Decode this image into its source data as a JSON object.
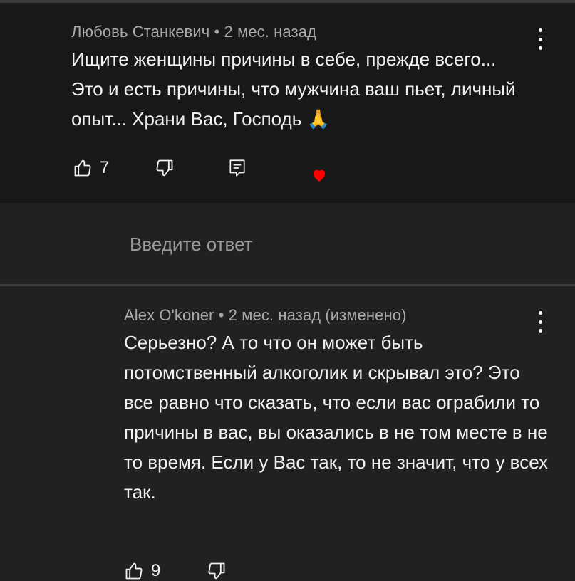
{
  "comment1": {
    "author": "Любовь Станкевич",
    "separator": "•",
    "time": "2 мес. назад",
    "text": "Ищите женщины причины в себе, прежде всего... Это и есть причины, что мужчина ваш пьет, личный опыт... Храни Вас, Господь 🙏",
    "likes": "7",
    "icons": [
      "thumbs-up-icon",
      "thumbs-down-icon",
      "reply-icon",
      "heart-icon",
      "more-vert-icon"
    ],
    "heart_color": "#ff0000"
  },
  "reply_input": {
    "placeholder": "Введите ответ"
  },
  "comment2": {
    "author": "Alex O'koner",
    "separator": "•",
    "time": "2 мес. назад (изменено)",
    "text": "Серьезно? А то  что он может быть потомственный алкоголик и скрывал это? Это все равно что сказать, что если вас ограбили то причины в вас, вы оказались в не том месте в не то время. Если у Вас так, то не значит, что у всех так.",
    "likes": "9",
    "icons": [
      "thumbs-up-icon",
      "thumbs-down-icon",
      "more-vert-icon"
    ]
  }
}
